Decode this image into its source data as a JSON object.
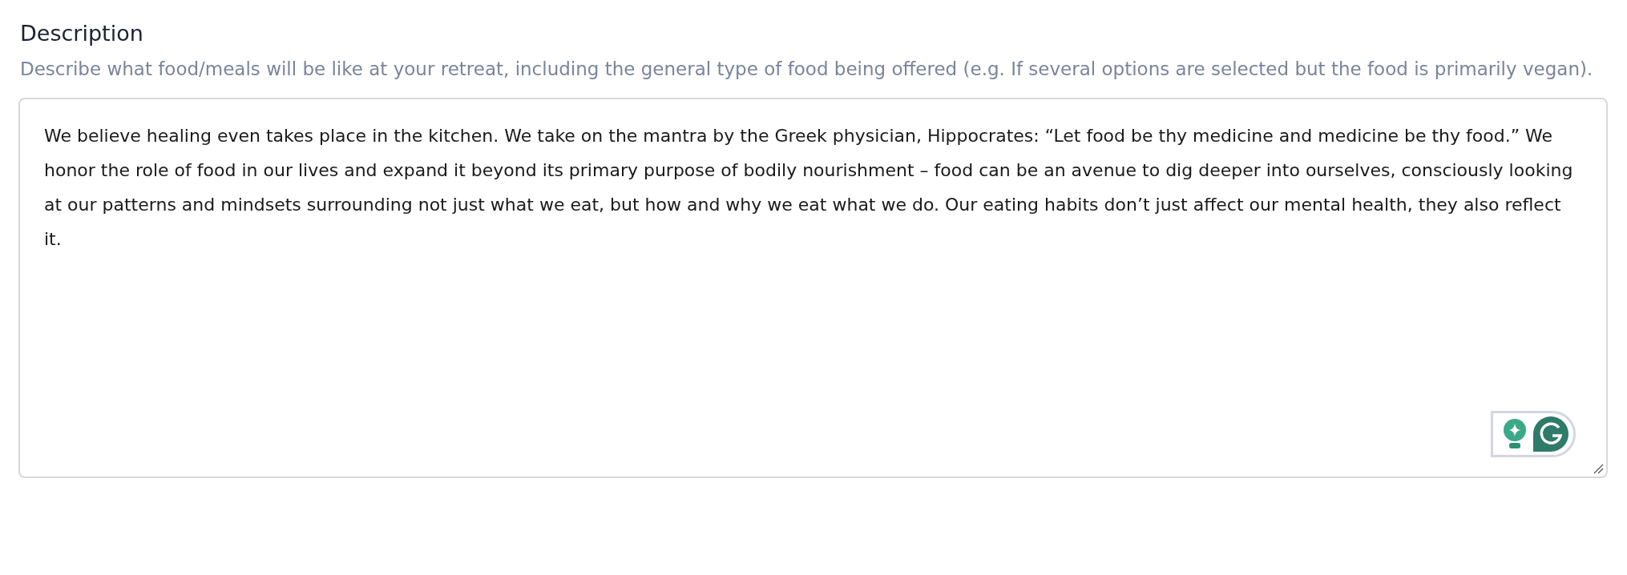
{
  "field": {
    "label": "Description",
    "help": "Describe what food/meals will be like at your retreat, including the general type of food being offered (e.g. If several options are selected but the food is primarily vegan).",
    "value": "We believe healing even takes place in the kitchen. We take on the mantra by the Greek physician, Hippocrates: “Let food be thy medicine and medicine be thy food.” We honor the role of food in our lives and expand it beyond its primary purpose of bodily nourishment – food can be an avenue to dig deeper into ourselves, consciously looking at our patterns and mindsets surrounding not just what we eat, but how and why we eat what we do. Our eating habits don’t just affect our mental health, they also reflect it."
  }
}
